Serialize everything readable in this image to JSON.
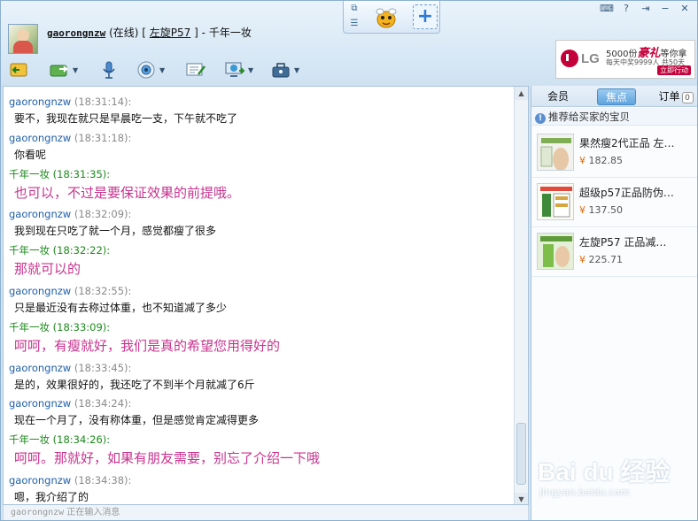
{
  "header": {
    "username": "gaorongnzw",
    "status": "(在线)",
    "bracket_open": "[",
    "shop_link": "左旋P57",
    "bracket_close": "]",
    "separator": "-",
    "shop_name": "千年一妆"
  },
  "ad": {
    "brand": "LG",
    "line1_count": "5000份",
    "line1_bold": "豪礼",
    "line1_tail": "等你拿",
    "line2": "每天中奖9999人 共50天",
    "button": "立即行动"
  },
  "chat": {
    "messages": [
      {
        "name": "gaorongnzw",
        "time": "(18:31:14):",
        "text": "要不，我现在就只是早晨吃一支，下午就不吃了",
        "self": false
      },
      {
        "name": "gaorongnzw",
        "time": "(18:31:18):",
        "text": "你看呢",
        "self": false
      },
      {
        "name": "千年一妆",
        "time": "(18:31:35):",
        "text": "也可以，不过是要保证效果的前提哦。",
        "self": true
      },
      {
        "name": "gaorongnzw",
        "time": "(18:32:09):",
        "text": "我到现在只吃了就一个月，感觉都瘦了很多",
        "self": false
      },
      {
        "name": "千年一妆",
        "time": "(18:32:22):",
        "text": "那就可以的",
        "self": true
      },
      {
        "name": "gaorongnzw",
        "time": "(18:32:55):",
        "text": "只是最近没有去称过体重，也不知道减了多少",
        "self": false
      },
      {
        "name": "千年一妆",
        "time": "(18:33:09):",
        "text": "呵呵，有瘦就好，我们是真的希望您用得好的",
        "self": true
      },
      {
        "name": "gaorongnzw",
        "time": "(18:33:45):",
        "text": "是的，效果很好的，我还吃了不到半个月就减了6斤",
        "self": false
      },
      {
        "name": "gaorongnzw",
        "time": "(18:34:24):",
        "text": "现在一个月了，没有称体重，但是感觉肯定减得更多",
        "self": false
      },
      {
        "name": "千年一妆",
        "time": "(18:34:26):",
        "text": "呵呵。那就好，如果有朋友需要，别忘了介绍一下哦",
        "self": true
      },
      {
        "name": "gaorongnzw",
        "time": "(18:34:38):",
        "text": "嗯，我介绍了的",
        "self": false
      }
    ]
  },
  "status_bar": {
    "user": "gaorongnzw",
    "text": "正在输入消息"
  },
  "right_panel": {
    "tabs": [
      {
        "label": "会员"
      },
      {
        "label": "焦点"
      },
      {
        "label": "订单",
        "badge": "0"
      }
    ],
    "recommend_title": "推荐给买家的宝贝",
    "products": [
      {
        "name": "果然瘦2代正品 左…",
        "currency": "¥",
        "price": "182.85"
      },
      {
        "name": "超级p57正品防伪…",
        "currency": "¥",
        "price": "137.50"
      },
      {
        "name": "左旋P57 正品减…",
        "currency": "¥",
        "price": "225.71"
      }
    ]
  },
  "watermark": {
    "brand": "Bai du 经验",
    "url": "jingyan.baidu.com"
  },
  "colors": {
    "other_name": "#1f5faa",
    "self_name": "#1a8a1a",
    "self_text": "#c8338f",
    "price_currency": "#e36b0b"
  }
}
